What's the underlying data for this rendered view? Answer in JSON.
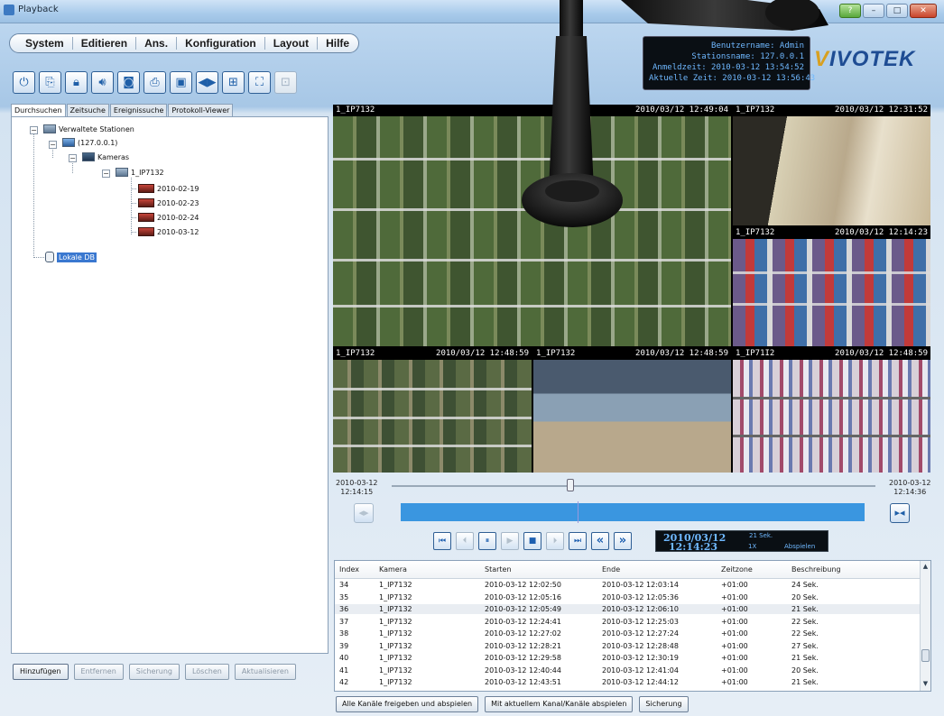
{
  "window": {
    "title": "Playback"
  },
  "menu": [
    "System",
    "Editieren",
    "Ans.",
    "Konfiguration",
    "Layout",
    "Hilfe"
  ],
  "toolbar_icons": [
    "power-icon",
    "export-icon",
    "lock-icon",
    "audio-icon",
    "snapshot-icon",
    "print-icon",
    "settings-icon",
    "record-icon",
    "layout-icon",
    "fullscreen-icon",
    "disabled-icon"
  ],
  "info": {
    "user": "Benutzername: Admin",
    "station": "Stationsname: 127.0.0.1",
    "login": "Anmeldzeit: 2010-03-12 13:54:52",
    "current": "Aktuelle Zeit: 2010-03-12 13:56:43"
  },
  "brand": {
    "v": "V",
    "rest": "IVOTEK"
  },
  "tabs": [
    "Durchsuchen",
    "Zeitsuche",
    "Ereignissuche",
    "Protokoll-Viewer"
  ],
  "tree": {
    "root": "Verwaltete Stationen",
    "station": "(127.0.0.1)",
    "folder": "Kameras",
    "camera": "1_IP7132",
    "dates": [
      "2010-02-19",
      "2010-02-23",
      "2010-02-24",
      "2010-03-12"
    ],
    "local": "Lokale DB"
  },
  "left_buttons": {
    "add": "Hinzufügen",
    "remove": "Entfernen",
    "backup": "Sicherung",
    "delete": "Löschen",
    "refresh": "Aktualisieren"
  },
  "cams": [
    {
      "name": "1_IP7132",
      "time": "2010/03/12 12:49:04"
    },
    {
      "name": "1_IP7132",
      "time": "2010/03/12 12:31:52"
    },
    {
      "name": "1_IP7132",
      "time": "2010/03/12 12:14:23"
    },
    {
      "name": "1_IP7132",
      "time": "2010/03/12 12:48:59"
    },
    {
      "name": "1_IP7132",
      "time": "2010/03/12 12:48:59"
    },
    {
      "name": "1_IP71I2",
      "time": "2010/03/12 12:48:59"
    }
  ],
  "timeline": {
    "start_date": "2010-03-12",
    "start_time": "12:14:15",
    "end_date": "2010-03-12",
    "end_time": "12:14:36",
    "position": 0.37
  },
  "playback": {
    "date": "2010/03/12",
    "time": "12:14:23",
    "duration": "21 Sek.",
    "speed": "1X",
    "status": "Abspielen"
  },
  "table": {
    "headers": [
      "Index",
      "Kamera",
      "Starten",
      "Ende",
      "Zeitzone",
      "Beschreibung"
    ],
    "rows": [
      [
        "34",
        "1_IP7132",
        "2010-03-12 12:02:50",
        "2010-03-12 12:03:14",
        "+01:00",
        "24 Sek."
      ],
      [
        "35",
        "1_IP7132",
        "2010-03-12 12:05:16",
        "2010-03-12 12:05:36",
        "+01:00",
        "20 Sek."
      ],
      [
        "36",
        "1_IP7132",
        "2010-03-12 12:05:49",
        "2010-03-12 12:06:10",
        "+01:00",
        "21 Sek."
      ],
      [
        "37",
        "1_IP7132",
        "2010-03-12 12:24:41",
        "2010-03-12 12:25:03",
        "+01:00",
        "22 Sek."
      ],
      [
        "38",
        "1_IP7132",
        "2010-03-12 12:27:02",
        "2010-03-12 12:27:24",
        "+01:00",
        "22 Sek."
      ],
      [
        "39",
        "1_IP7132",
        "2010-03-12 12:28:21",
        "2010-03-12 12:28:48",
        "+01:00",
        "27 Sek."
      ],
      [
        "40",
        "1_IP7132",
        "2010-03-12 12:29:58",
        "2010-03-12 12:30:19",
        "+01:00",
        "21 Sek."
      ],
      [
        "41",
        "1_IP7132",
        "2010-03-12 12:40:44",
        "2010-03-12 12:41:04",
        "+01:00",
        "20 Sek."
      ],
      [
        "42",
        "1_IP7132",
        "2010-03-12 12:43:51",
        "2010-03-12 12:44:12",
        "+01:00",
        "21 Sek."
      ]
    ]
  },
  "bottom_buttons": [
    "Alle Kanäle freigeben und abspielen",
    "Mit aktuellem Kanal/Kanäle abspielen",
    "Sicherung"
  ],
  "colors": {
    "accent": "#3a96e0",
    "info_text": "#6fb8ff"
  }
}
